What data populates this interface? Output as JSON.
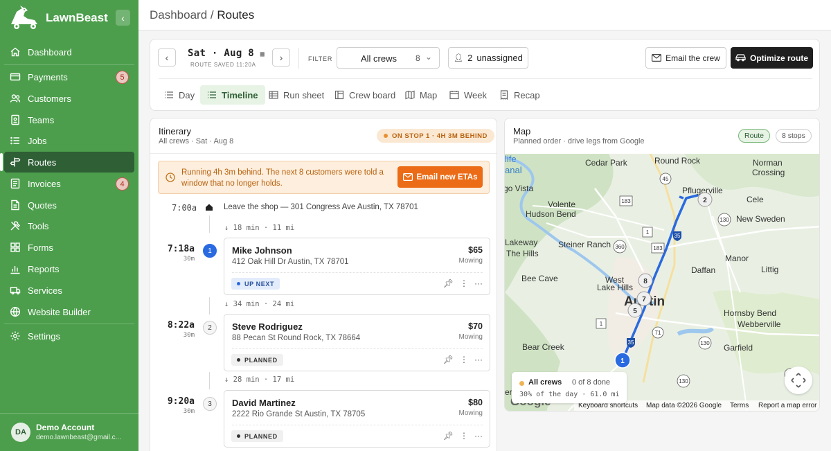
{
  "brand": {
    "name": "LawnBeast"
  },
  "nav": {
    "items": [
      {
        "label": "Dashboard",
        "icon": "home-icon"
      },
      {
        "label": "Payments",
        "icon": "credit-card-icon",
        "badge": "5"
      },
      {
        "label": "Customers",
        "icon": "users-icon"
      },
      {
        "label": "Teams",
        "icon": "id-badge-icon"
      },
      {
        "label": "Jobs",
        "icon": "list-icon"
      },
      {
        "label": "Routes",
        "icon": "signpost-icon",
        "active": true
      },
      {
        "label": "Invoices",
        "icon": "invoice-icon",
        "badge": "4"
      },
      {
        "label": "Quotes",
        "icon": "document-icon"
      },
      {
        "label": "Tools",
        "icon": "tools-icon"
      },
      {
        "label": "Forms",
        "icon": "grid-icon"
      },
      {
        "label": "Reports",
        "icon": "bar-chart-icon"
      },
      {
        "label": "Services",
        "icon": "truck-icon"
      },
      {
        "label": "Website Builder",
        "icon": "globe-icon"
      },
      {
        "label": "Settings",
        "icon": "gear-icon"
      }
    ]
  },
  "account": {
    "initials": "DA",
    "name": "Demo Account",
    "email": "demo.lawnbeast@gmail.c..."
  },
  "breadcrumb": {
    "parent": "Dashboard",
    "sep": "/",
    "current": "Routes"
  },
  "controls": {
    "date": "Sat · Aug 8",
    "saved": "ROUTE SAVED 11:20A",
    "filter_label": "FILTER",
    "crew_select": "All crews",
    "crew_count": "8",
    "unassigned_count": "2",
    "unassigned_label": "unassigned",
    "email_crew": "Email the crew",
    "optimize": "Optimize route"
  },
  "tabs": [
    {
      "label": "Day",
      "icon": "list-icon"
    },
    {
      "label": "Timeline",
      "icon": "timeline-icon",
      "active": true
    },
    {
      "label": "Run sheet",
      "icon": "table-icon"
    },
    {
      "label": "Crew board",
      "icon": "board-icon"
    },
    {
      "label": "Map",
      "icon": "map-icon"
    },
    {
      "label": "Week",
      "icon": "calendar-icon"
    },
    {
      "label": "Recap",
      "icon": "receipt-icon"
    }
  ],
  "itinerary": {
    "title": "Itinerary",
    "subtitle": "All crews · Sat · Aug 8",
    "status_badge": "ON STOP 1 · 4H 3M BEHIND",
    "alert_text": "Running 4h 3m behind. The next 8 customers were told a window that no longer holds.",
    "alert_button": "Email new ETAs",
    "start": {
      "time": "7:00a",
      "text": "Leave the shop — 301 Congress Ave Austin, TX 78701"
    },
    "legs": [
      "18 min · 11 mi",
      "34 min · 24 mi",
      "28 min · 17 mi"
    ],
    "stops": [
      {
        "num": "1",
        "time": "7:18a",
        "duration": "30m",
        "name": "Mike Johnson",
        "address": "412 Oak Hill Dr Austin, TX 78701",
        "price": "$65",
        "service": "Mowing",
        "status": "UP NEXT"
      },
      {
        "num": "2",
        "time": "8:22a",
        "duration": "30m",
        "name": "Steve Rodriguez",
        "address": "88 Pecan St Round Rock, TX 78664",
        "price": "$70",
        "service": "Mowing",
        "status": "PLANNED"
      },
      {
        "num": "3",
        "time": "9:20a",
        "duration": "30m",
        "name": "David Martinez",
        "address": "2222 Rio Grande St Austin, TX 78705",
        "price": "$80",
        "service": "Mowing",
        "status": "PLANNED"
      }
    ]
  },
  "map": {
    "title": "Map",
    "subtitle": "Planned order · drive legs from Google",
    "route_badge": "Route",
    "stops_badge": "8 stops",
    "places": [
      "Cedar Park",
      "Round Rock",
      "Norman",
      "Crossing",
      "Pflugerville",
      "Cele",
      "New Sweden",
      "Volente",
      "Hudson Bend",
      "Steiner Ranch",
      "Lakeway",
      "The Hills",
      "Manor",
      "Littig",
      "Daffan",
      "Bee Cave",
      "West",
      "Lake Hills",
      "Austin",
      "Hornsby Bend",
      "Webberville",
      "Bear Creek",
      "Garfield",
      "go Vista",
      "life",
      "anal",
      "er"
    ],
    "shields": [
      "45",
      "183",
      "1",
      "130",
      "360",
      "183",
      "1",
      "71",
      "130",
      "130",
      "71",
      "35",
      "35"
    ],
    "markers": [
      "1",
      "2",
      "5",
      "7",
      "8"
    ],
    "legend_label": "All crews",
    "legend_done": "0 of 8 done",
    "legend_pct": "30% of the day · 61.0 mi",
    "google": "Google",
    "attribution": [
      "Keyboard shortcuts",
      "Map data ©2026 Google",
      "Terms",
      "Report a map error"
    ]
  }
}
